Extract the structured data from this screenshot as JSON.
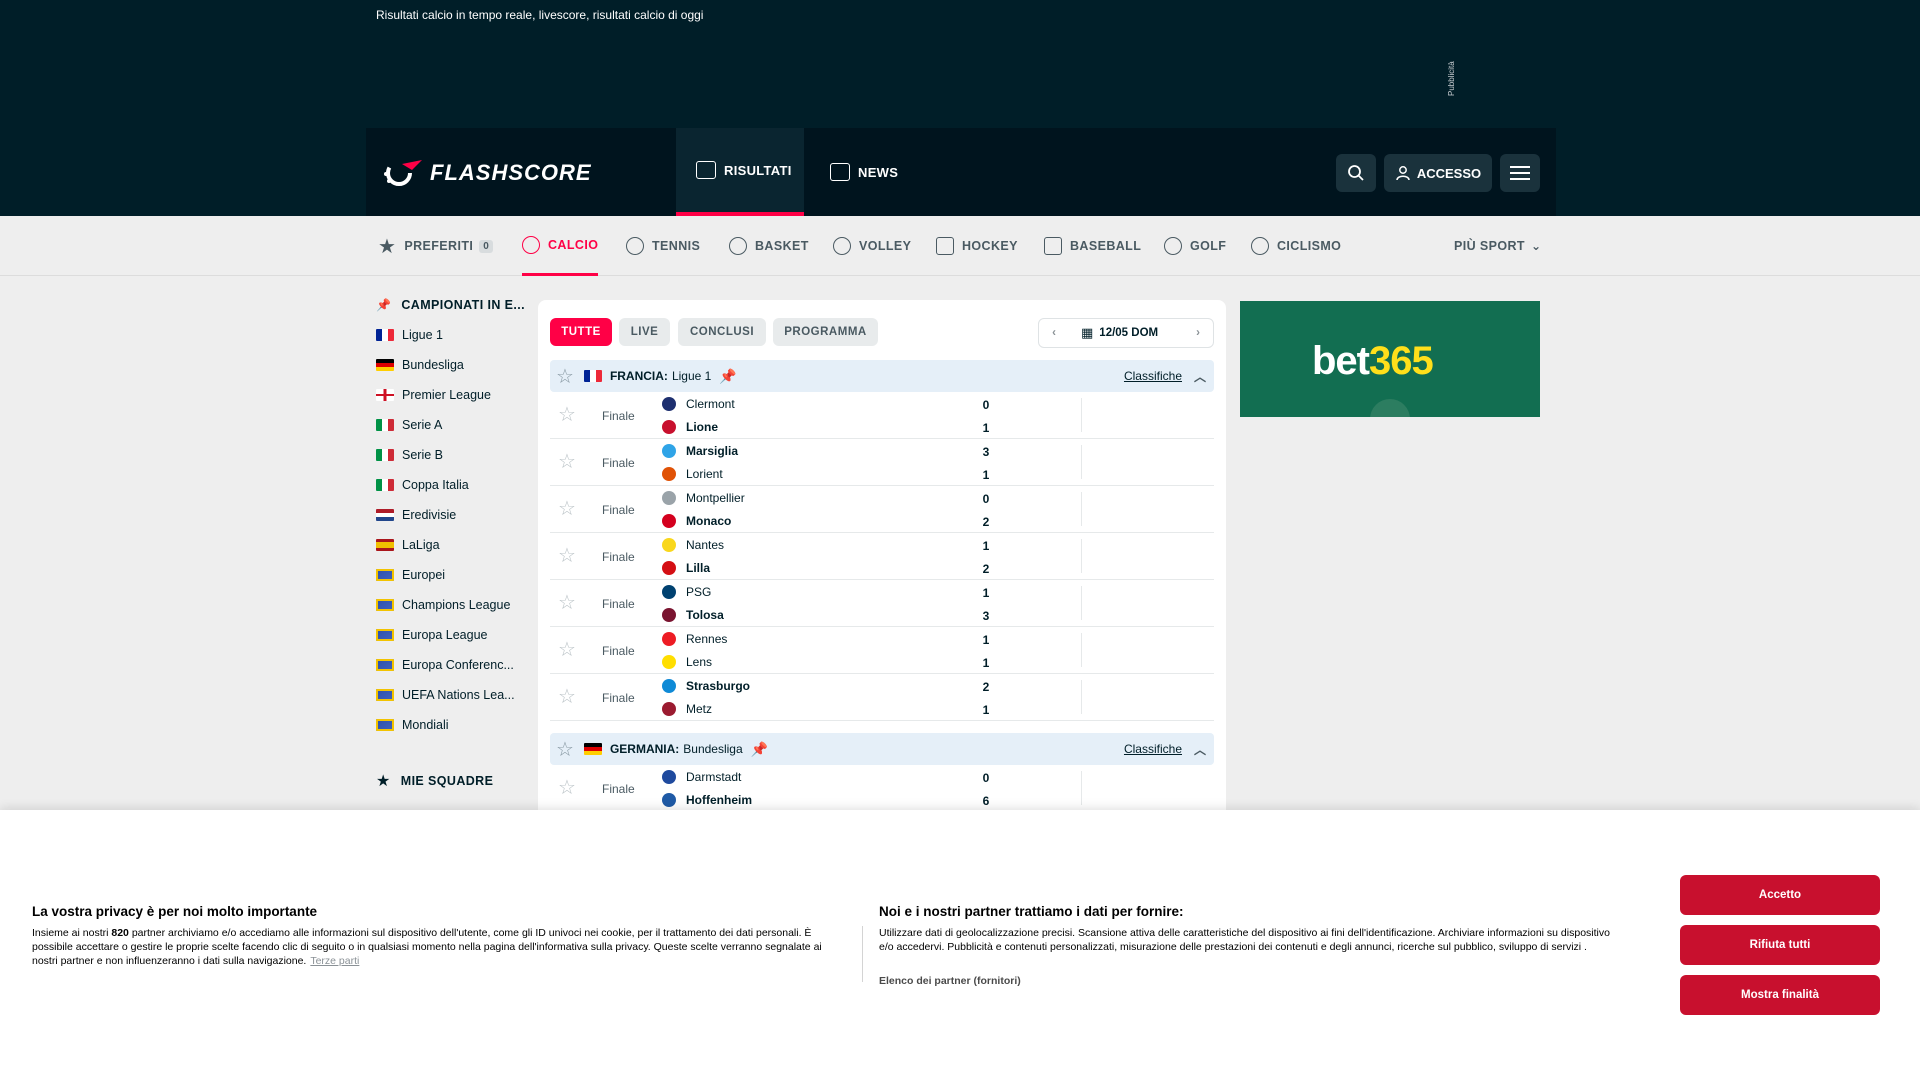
{
  "top_ad": {
    "tagline": "Risultati calcio in tempo reale, livescore, risultati calcio di oggi",
    "label": "Pubblicità"
  },
  "header": {
    "logo_text": "FLASHSCORE",
    "tabs": [
      {
        "label": "RISULTATI",
        "icon": "scoreboard-icon"
      },
      {
        "label": "NEWS",
        "icon": "newspaper-icon"
      }
    ],
    "login_label": "ACCESSO"
  },
  "sports": [
    {
      "label": "PREFERITI",
      "count": "0"
    },
    {
      "label": "CALCIO"
    },
    {
      "label": "TENNIS"
    },
    {
      "label": "BASKET"
    },
    {
      "label": "VOLLEY"
    },
    {
      "label": "HOCKEY"
    },
    {
      "label": "BASEBALL"
    },
    {
      "label": "GOLF"
    },
    {
      "label": "CICLISMO"
    },
    {
      "label": "PIÙ SPORT"
    }
  ],
  "sidebar": {
    "pinned_title": "CAMPIONATI IN E...",
    "leagues": [
      {
        "label": "Ligue 1",
        "flag": "france"
      },
      {
        "label": "Bundesliga",
        "flag": "germany"
      },
      {
        "label": "Premier League",
        "flag": "england"
      },
      {
        "label": "Serie A",
        "flag": "italy"
      },
      {
        "label": "Serie B",
        "flag": "italy"
      },
      {
        "label": "Coppa Italia",
        "flag": "italy"
      },
      {
        "label": "Eredivisie",
        "flag": "netherlands"
      },
      {
        "label": "LaLiga",
        "flag": "spain"
      },
      {
        "label": "Europei",
        "flag": "europe"
      },
      {
        "label": "Champions League",
        "flag": "europe"
      },
      {
        "label": "Europa League",
        "flag": "europe"
      },
      {
        "label": "Europa Conferenc...",
        "flag": "europe"
      },
      {
        "label": "UEFA Nations Lea...",
        "flag": "europe"
      },
      {
        "label": "Mondiali",
        "flag": "world"
      }
    ],
    "my_teams_title": "MIE SQUADRE"
  },
  "filters": {
    "all": "TUTTE",
    "live": "LIVE",
    "finished": "CONCLUSI",
    "scheduled": "PROGRAMMA"
  },
  "date_label": "12/05 DOM",
  "standings_label": "Classifiche",
  "leagues": [
    {
      "country": "FRANCIA:",
      "name": "Ligue 1",
      "matches": [
        {
          "status": "Finale",
          "home": "Clermont",
          "away": "Lione",
          "home_score": "0",
          "away_score": "1",
          "winner": "away"
        },
        {
          "status": "Finale",
          "home": "Marsiglia",
          "away": "Lorient",
          "home_score": "3",
          "away_score": "1",
          "winner": "home"
        },
        {
          "status": "Finale",
          "home": "Montpellier",
          "away": "Monaco",
          "home_score": "0",
          "away_score": "2",
          "winner": "away"
        },
        {
          "status": "Finale",
          "home": "Nantes",
          "away": "Lilla",
          "home_score": "1",
          "away_score": "2",
          "winner": "away"
        },
        {
          "status": "Finale",
          "home": "PSG",
          "away": "Tolosa",
          "home_score": "1",
          "away_score": "3",
          "winner": "away"
        },
        {
          "status": "Finale",
          "home": "Rennes",
          "away": "Lens",
          "home_score": "1",
          "away_score": "1",
          "winner": "none"
        },
        {
          "status": "Finale",
          "home": "Strasburgo",
          "away": "Metz",
          "home_score": "2",
          "away_score": "1",
          "winner": "home"
        }
      ]
    },
    {
      "country": "GERMANIA:",
      "name": "Bundesliga",
      "matches": [
        {
          "status": "Finale",
          "home": "Darmstadt",
          "away": "Hoffenheim",
          "home_score": "0",
          "away_score": "6",
          "winner": "away"
        }
      ]
    }
  ],
  "right_ad": {
    "brand_prefix": "bet",
    "brand_suffix": "365"
  },
  "cookie": {
    "title": "La vostra privacy è per noi molto importante",
    "text_before": "Insieme ai nostri ",
    "partners_count": "820",
    "text_after": " partner archiviamo e/o accediamo alle informazioni sul dispositivo dell'utente, come gli ID univoci nei cookie, per il trattamento dei dati personali. È possibile accettare o gestire le proprie scelte facendo clic di seguito o in qualsiasi momento nella pagina dell'informativa sulla privacy. Queste scelte verranno segnalate ai nostri partner e non influenzeranno i dati sulla navigazione.",
    "third_parties_link": "Terze parti",
    "purposes_title": "Noi e i nostri partner trattiamo i dati per fornire:",
    "purposes_text": "Utilizzare dati di geolocalizzazione precisi. Scansione attiva delle caratteristiche del dispositivo ai fini dell'identificazione. Archiviare informazioni su dispositivo e/o accedervi. Pubblicità e contenuti personalizzati, misurazione delle prestazioni dei contenuti e degli annunci, ricerche sul pubblico, sviluppo di servizi .",
    "vendors_link": "Elenco dei partner (fornitori)",
    "accept": "Accetto",
    "reject": "Rifiuta tutti",
    "show_purposes": "Mostra finalità"
  },
  "colors": {
    "accent": "#ff0046",
    "header_bg": "#001e28",
    "cookie_button": "#c8102e",
    "league_head_bg": "#e5eff8"
  }
}
